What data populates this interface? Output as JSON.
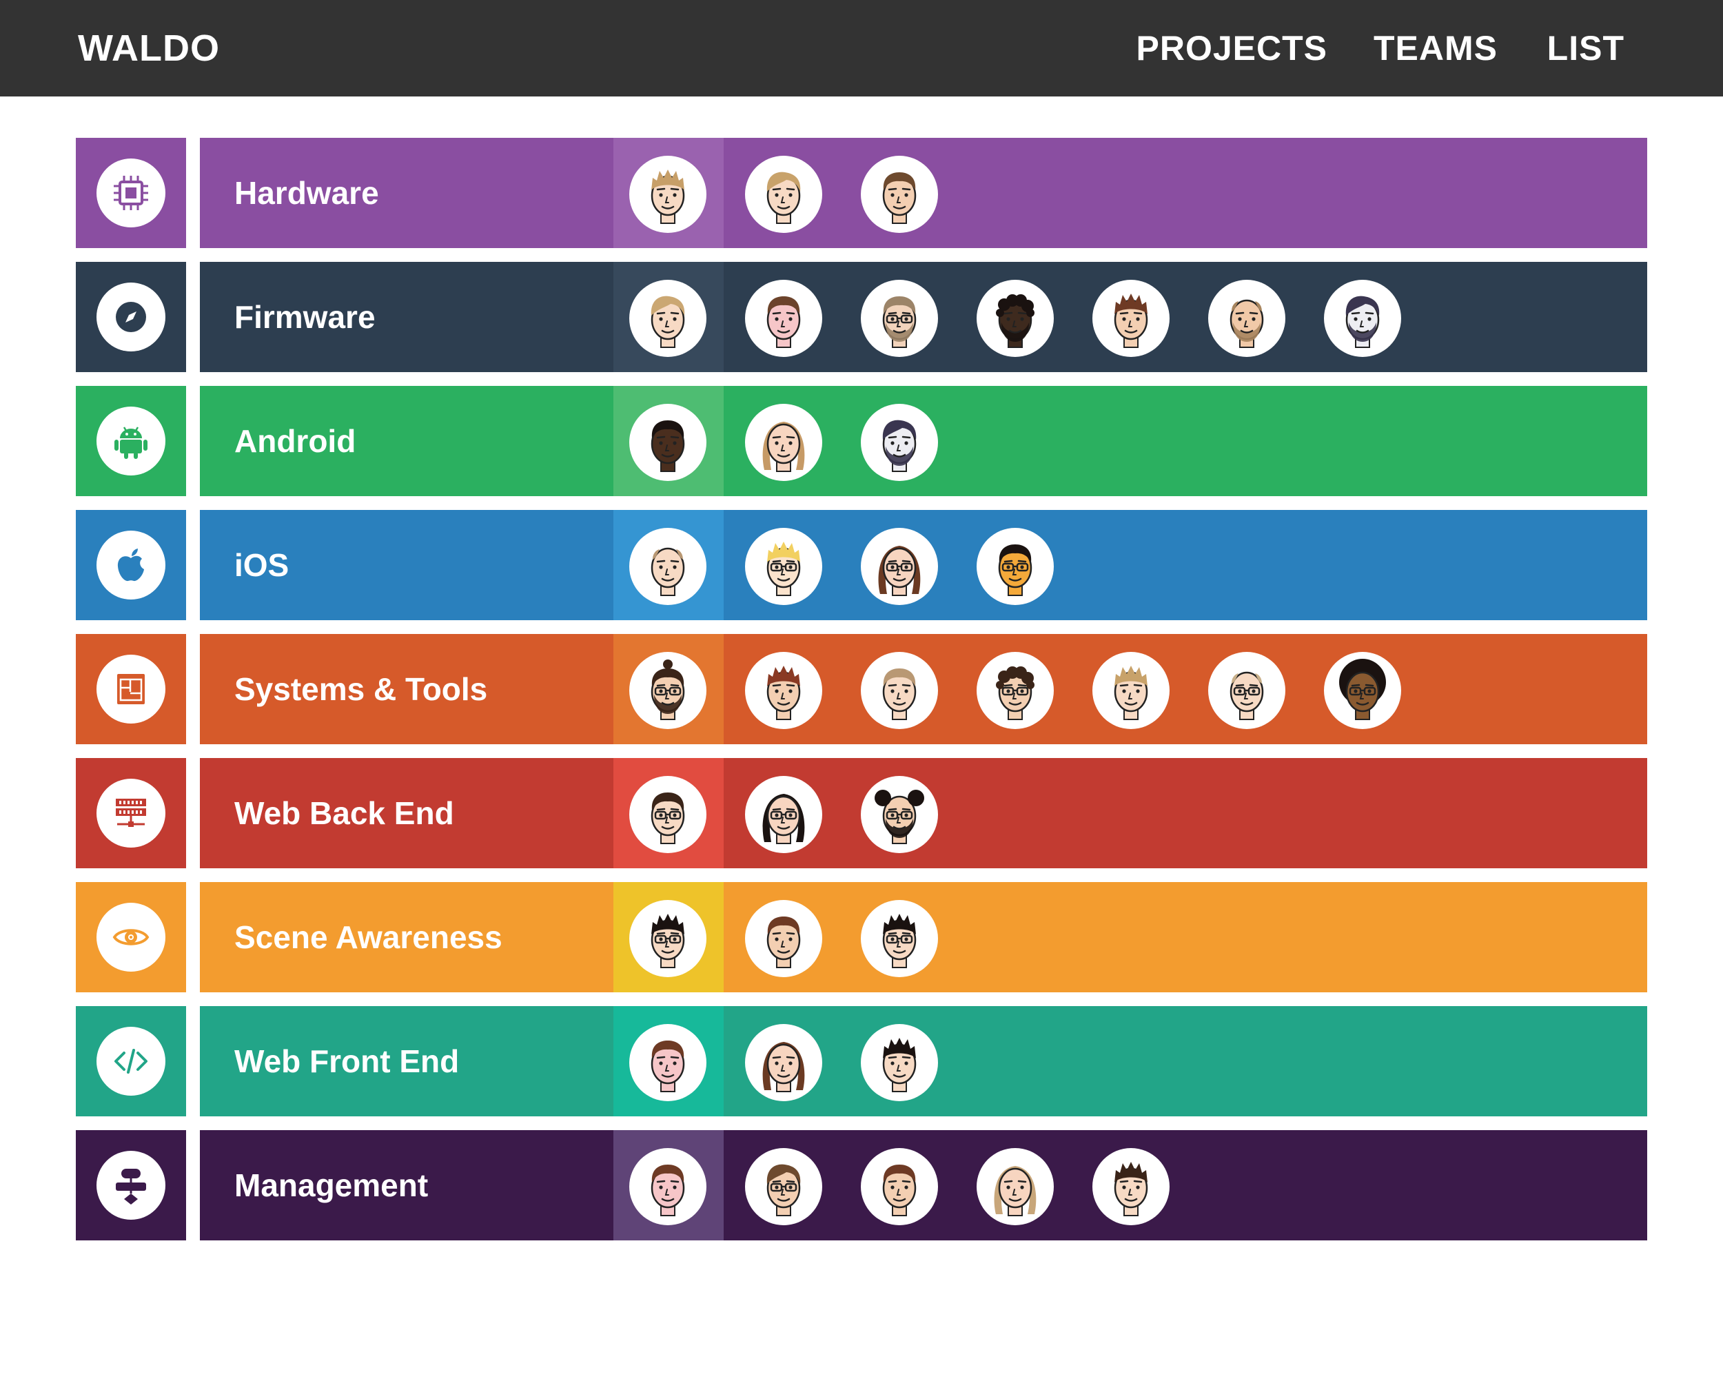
{
  "header": {
    "brand": "WALDO",
    "nav": [
      "PROJECTS",
      "TEAMS",
      "LIST"
    ]
  },
  "teams": [
    {
      "name": "Hardware",
      "icon": "chip-icon",
      "color": "#8A4EA1",
      "lead_color": "#9A62AF",
      "members": [
        {
          "skin": "#F7DAC4",
          "hair": "#C79F68",
          "glasses": false,
          "beard": false,
          "hair_style": "spiky"
        },
        {
          "skin": "#F7DAC4",
          "hair": "#C8A26A",
          "glasses": false,
          "beard": false,
          "hair_style": "side"
        },
        {
          "skin": "#F3CFB2",
          "hair": "#6E4A2E",
          "glasses": false,
          "beard": false,
          "hair_style": "short"
        }
      ]
    },
    {
      "name": "Firmware",
      "icon": "compass-icon",
      "color": "#2D3E50",
      "lead_color": "#37495C",
      "members": [
        {
          "skin": "#F7DAC4",
          "hair": "#CBA772",
          "glasses": false,
          "beard": false,
          "hair_style": "side"
        },
        {
          "skin": "#F6C6C8",
          "hair": "#6C432B",
          "glasses": false,
          "beard": false,
          "hair_style": "short"
        },
        {
          "skin": "#F2D3BB",
          "hair": "#9C8468",
          "glasses": true,
          "beard": true,
          "hair_style": "short"
        },
        {
          "skin": "#3E2A1E",
          "hair": "#1A1210",
          "glasses": false,
          "beard": true,
          "hair_style": "curly"
        },
        {
          "skin": "#F3CFB2",
          "hair": "#6E3A24",
          "glasses": false,
          "beard": false,
          "hair_style": "spiky"
        },
        {
          "skin": "#F1C9A8",
          "hair": "#A8855E",
          "glasses": false,
          "beard": true,
          "hair_style": "bald"
        },
        {
          "skin": "#EDEDF2",
          "hair": "#3A3550",
          "glasses": false,
          "beard": true,
          "hair_style": "side"
        }
      ]
    },
    {
      "name": "Android",
      "icon": "android-icon",
      "color": "#2BB060",
      "lead_color": "#4EBD72",
      "members": [
        {
          "skin": "#4A2E1E",
          "hair": "#1A1210",
          "glasses": false,
          "beard": false,
          "hair_style": "short"
        },
        {
          "skin": "#F7D5C0",
          "hair": "#C69A66",
          "glasses": false,
          "beard": false,
          "hair_style": "long"
        },
        {
          "skin": "#EDEDF2",
          "hair": "#3A3550",
          "glasses": false,
          "beard": true,
          "hair_style": "side"
        }
      ]
    },
    {
      "name": "iOS",
      "icon": "apple-icon",
      "color": "#2A80BD",
      "lead_color": "#3595D2",
      "members": [
        {
          "skin": "#F7DAC4",
          "hair": "#B99873",
          "glasses": false,
          "beard": false,
          "hair_style": "bald"
        },
        {
          "skin": "#FBE3CC",
          "hair": "#F2D060",
          "glasses": true,
          "beard": false,
          "hair_style": "spiky"
        },
        {
          "skin": "#F7D5C0",
          "hair": "#6B3A22",
          "glasses": true,
          "beard": false,
          "hair_style": "long"
        },
        {
          "skin": "#F4A93A",
          "hair": "#1A1210",
          "glasses": true,
          "beard": false,
          "hair_style": "short"
        }
      ]
    },
    {
      "name": "Systems & Tools",
      "icon": "blueprint-icon",
      "color": "#D65A2A",
      "lead_color": "#E37630",
      "members": [
        {
          "skin": "#F3CFB2",
          "hair": "#3A2418",
          "glasses": true,
          "beard": true,
          "hair_style": "bun"
        },
        {
          "skin": "#F3CFB2",
          "hair": "#8A3A24",
          "glasses": false,
          "beard": false,
          "hair_style": "spiky"
        },
        {
          "skin": "#F7DAC4",
          "hair": "#B99873",
          "glasses": false,
          "beard": false,
          "hair_style": "short"
        },
        {
          "skin": "#F3CFB2",
          "hair": "#3A2418",
          "glasses": true,
          "beard": false,
          "hair_style": "curly"
        },
        {
          "skin": "#F7DAC4",
          "hair": "#C8A26A",
          "glasses": false,
          "beard": false,
          "hair_style": "spiky"
        },
        {
          "skin": "#F7DAC4",
          "hair": "#C9B08A",
          "glasses": true,
          "beard": false,
          "hair_style": "bald"
        },
        {
          "skin": "#8A5A30",
          "hair": "#1A1210",
          "glasses": true,
          "beard": false,
          "hair_style": "afro"
        }
      ]
    },
    {
      "name": "Web Back End",
      "icon": "server-icon",
      "color": "#C23B31",
      "lead_color": "#E14C40",
      "members": [
        {
          "skin": "#F7DAC4",
          "hair": "#3A2418",
          "glasses": true,
          "beard": false,
          "hair_style": "short"
        },
        {
          "skin": "#F7D5C0",
          "hair": "#1A1210",
          "glasses": true,
          "beard": false,
          "hair_style": "long"
        },
        {
          "skin": "#F3CFB2",
          "hair": "#1A1210",
          "glasses": true,
          "beard": true,
          "hair_style": "puffs"
        }
      ]
    },
    {
      "name": "Scene Awareness",
      "icon": "eye-icon",
      "color": "#F39C2F",
      "lead_color": "#EEC32A",
      "members": [
        {
          "skin": "#F7DAC4",
          "hair": "#1A1210",
          "glasses": true,
          "beard": false,
          "hair_style": "spiky"
        },
        {
          "skin": "#F3CFB2",
          "hair": "#6E3A24",
          "glasses": false,
          "beard": false,
          "hair_style": "short"
        },
        {
          "skin": "#F7DAC4",
          "hair": "#1A1210",
          "glasses": true,
          "beard": false,
          "hair_style": "spiky"
        }
      ]
    },
    {
      "name": "Web Front End",
      "icon": "code-icon",
      "color": "#22A588",
      "lead_color": "#17B99A",
      "members": [
        {
          "skin": "#F6C6C8",
          "hair": "#6E3A24",
          "glasses": false,
          "beard": false,
          "hair_style": "short"
        },
        {
          "skin": "#F7D5C0",
          "hair": "#6B3A22",
          "glasses": false,
          "beard": false,
          "hair_style": "long"
        },
        {
          "skin": "#F7DAC4",
          "hair": "#1A1210",
          "glasses": false,
          "beard": false,
          "hair_style": "spiky"
        }
      ]
    },
    {
      "name": "Management",
      "icon": "flowchart-icon",
      "color": "#3B1A4A",
      "lead_color": "#5F4477",
      "members": [
        {
          "skin": "#F6C6C8",
          "hair": "#6E3A24",
          "glasses": false,
          "beard": false,
          "hair_style": "short"
        },
        {
          "skin": "#F3CFB2",
          "hair": "#6E4A2E",
          "glasses": true,
          "beard": false,
          "hair_style": "side"
        },
        {
          "skin": "#F3CFB2",
          "hair": "#6E3A24",
          "glasses": false,
          "beard": false,
          "hair_style": "short"
        },
        {
          "skin": "#F7D5C0",
          "hair": "#C8A67A",
          "glasses": false,
          "beard": false,
          "hair_style": "long"
        },
        {
          "skin": "#F7DAC4",
          "hair": "#3A2418",
          "glasses": false,
          "beard": false,
          "hair_style": "spiky"
        }
      ]
    }
  ]
}
